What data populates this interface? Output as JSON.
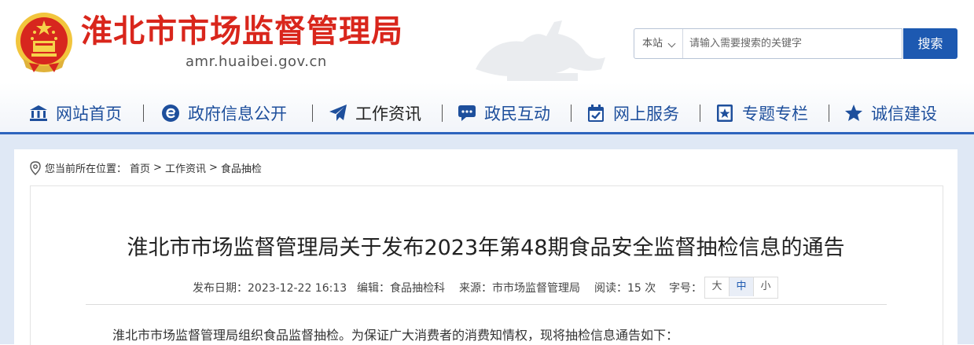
{
  "header": {
    "site_title": "淮北市市场监督管理局",
    "domain": "amr.huaibei.gov.cn",
    "emblem_icon": "national-emblem-icon",
    "search": {
      "scope": "本站",
      "placeholder": "请输入需要搜索的关键字",
      "value": "",
      "button": "搜索"
    }
  },
  "nav": {
    "items": [
      {
        "label": "网站首页",
        "icon": "bank-icon"
      },
      {
        "label": "政府信息公开",
        "icon": "e-icon"
      },
      {
        "label": "工作资讯",
        "icon": "paper-plane-icon",
        "active": true
      },
      {
        "label": "政民互动",
        "icon": "chat-icon"
      },
      {
        "label": "网上服务",
        "icon": "calendar-check-icon"
      },
      {
        "label": "专题专栏",
        "icon": "star-board-icon"
      },
      {
        "label": "诚信建设",
        "icon": "star-icon"
      }
    ]
  },
  "breadcrumb": {
    "prefix": "您当前所在位置：",
    "items": [
      "首页",
      "工作资讯",
      "食品抽检"
    ],
    "separator": ">"
  },
  "article": {
    "title": "淮北市市场监督管理局关于发布2023年第48期食品安全监督抽检信息的通告",
    "meta": {
      "date": "发布日期：2023-12-22 16:13",
      "editor": "编辑：食品抽检科",
      "source": "来源：市市场监督管理局",
      "reads": "阅读：15 次",
      "fontsize_label": "字号：",
      "fontsize_options": [
        "大",
        "中",
        "小"
      ],
      "fontsize_selected": "中"
    },
    "first_paragraph": "淮北市市场监督管理局组织食品监督抽检。为保证广大消费者的消费知情权，现将抽检信息通告如下："
  },
  "colors": {
    "brand_red": "#d9261c",
    "nav_blue": "#1e4f9c",
    "accent_blue": "#1d59b1",
    "page_bg": "#dfe8f5"
  }
}
